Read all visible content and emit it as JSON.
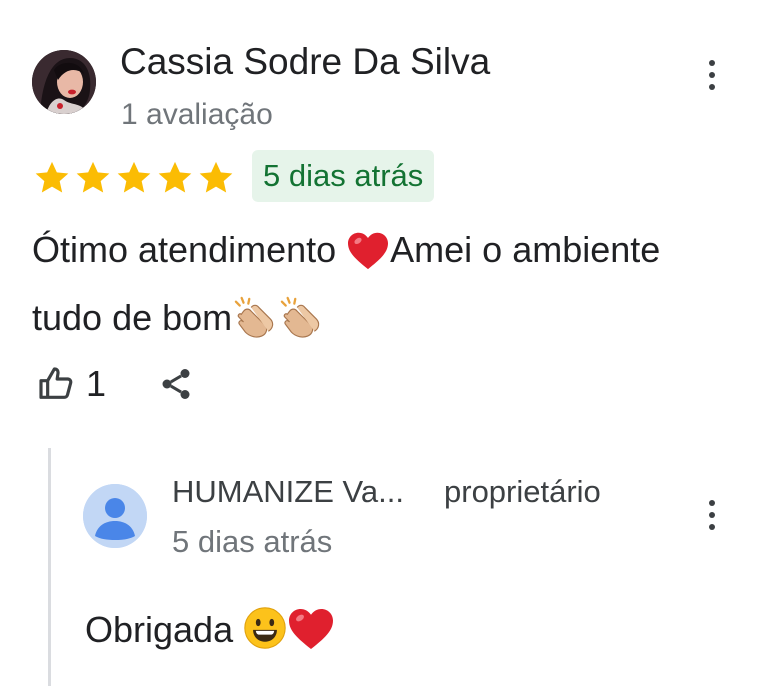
{
  "review": {
    "author_name": "Cassia Sodre Da Silva",
    "author_review_count": "1 avaliação",
    "rating": 5,
    "rating_max": 5,
    "date": "5 dias atrás",
    "text_part1": "Ótimo atendimento ",
    "text_part2": "Amei o ambiente tudo de bom",
    "emoji_heart": "heart-emoji",
    "emoji_clap": "clapping-hands-emoji",
    "like_count": "1",
    "icons": {
      "more": "more-vert-icon",
      "like": "thumbs-up-icon",
      "share": "share-icon",
      "star": "star-icon"
    },
    "star_color": "#fbbc04"
  },
  "owner_reply": {
    "author_name": "HUMANIZE Va...",
    "role": "proprietário",
    "date": "5 dias atrás",
    "text": "Obrigada ",
    "emojis": [
      "grinning-face-emoji",
      "heart-emoji"
    ],
    "avatar_icon": "default-person-avatar-icon"
  },
  "colors": {
    "badge_bg": "#e6f4ea",
    "badge_text": "#137333",
    "secondary_text": "#70757a"
  }
}
